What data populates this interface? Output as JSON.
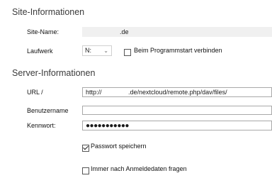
{
  "site": {
    "title": "Site-Informationen",
    "name_label": "Site-Name:",
    "name_value": ".de",
    "drive_label": "Laufwerk",
    "drive_value": "N:",
    "autostart_label": "Beim Programmstart verbinden",
    "autostart_checked": false
  },
  "server": {
    "title": "Server-Informationen",
    "url_label": "URL /",
    "url_value": "http://               .de/nextcloud/remote.php/dav/files/",
    "user_label": "Benutzername",
    "user_value": "",
    "password_label": "Kennwort:",
    "password_value": "●●●●●●●●●●●",
    "save_password_label": "Passwort speichern",
    "save_password_checked": true,
    "always_ask_label": "Immer nach Anmeldedaten fragen",
    "always_ask_checked": false
  }
}
